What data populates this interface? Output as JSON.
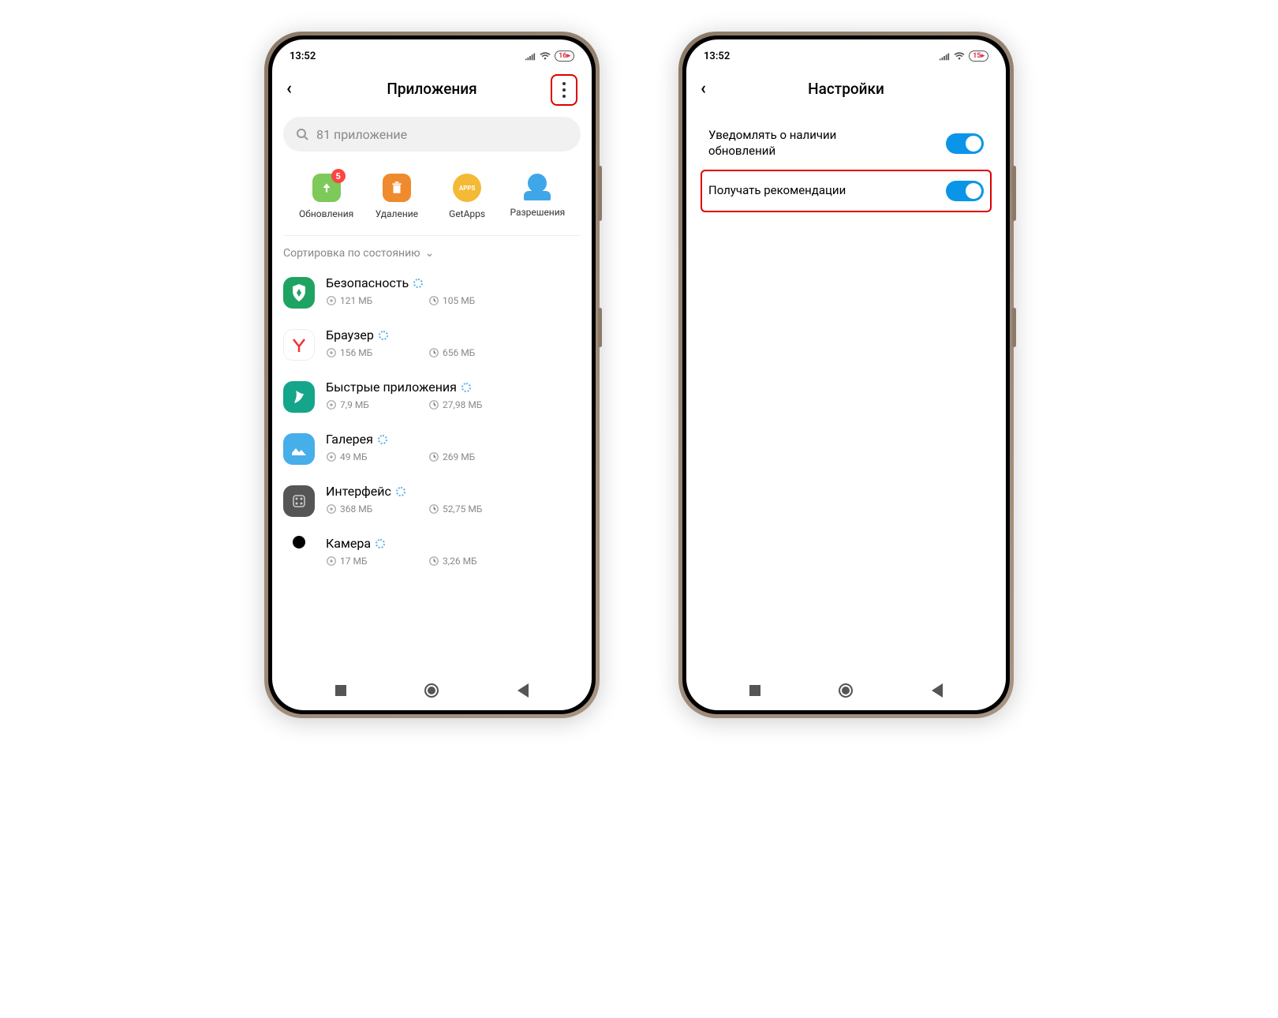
{
  "phone1": {
    "status": {
      "time": "13:52",
      "battery": "16"
    },
    "header": {
      "title": "Приложения"
    },
    "search": {
      "placeholder": "81 приложение"
    },
    "quick": {
      "updates": {
        "label": "Обновления",
        "badge": "5"
      },
      "uninstall": {
        "label": "Удаление"
      },
      "getapps": {
        "label": "GetApps"
      },
      "permissions": {
        "label": "Разрешения"
      }
    },
    "sort": {
      "label": "Сортировка по состоянию"
    },
    "apps": [
      {
        "name": "Безопасность",
        "storage": "121 МБ",
        "ram": "105 МБ",
        "icon": "shield"
      },
      {
        "name": "Браузер",
        "storage": "156 МБ",
        "ram": "656 МБ",
        "icon": "yandex"
      },
      {
        "name": "Быстрые приложения",
        "storage": "7,9 МБ",
        "ram": "27,98 МБ",
        "icon": "quickapp"
      },
      {
        "name": "Галерея",
        "storage": "49 МБ",
        "ram": "269 МБ",
        "icon": "gallery"
      },
      {
        "name": "Интерфейс",
        "storage": "368 МБ",
        "ram": "52,75 МБ",
        "icon": "interface"
      },
      {
        "name": "Камера",
        "storage": "17 МБ",
        "ram": "3,26 МБ",
        "icon": "camera"
      }
    ]
  },
  "phone2": {
    "status": {
      "time": "13:52",
      "battery": "15"
    },
    "header": {
      "title": "Настройки"
    },
    "settings": {
      "notify_updates": {
        "label": "Уведомлять о наличии обновлений",
        "value": true
      },
      "recommendations": {
        "label": "Получать рекомендации",
        "value": true
      }
    }
  }
}
